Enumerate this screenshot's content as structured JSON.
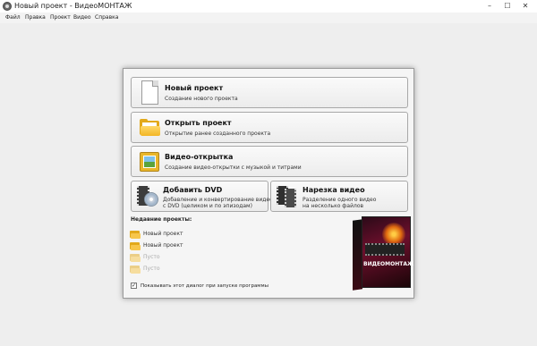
{
  "window": {
    "title": "Новый проект - ВидеоМОНТАЖ",
    "minimize": "–",
    "maximize": "☐",
    "close": "✕"
  },
  "menu": [
    "Файл",
    "Правка",
    "Проект",
    "Видео",
    "Справка"
  ],
  "actions": {
    "new_project": {
      "title": "Новый проект",
      "desc": "Создание нового проекта",
      "icon": "document-icon"
    },
    "open_project": {
      "title": "Открыть проект",
      "desc": "Открытие ранее созданного проекта",
      "icon": "folder-icon"
    },
    "video_card": {
      "title": "Видео-открытка",
      "desc": "Создание видео-открытки с музыкой и титрами",
      "icon": "photo-icon"
    },
    "add_dvd": {
      "title": "Добавить DVD",
      "desc_line1": "Добавление и конвертирование видео",
      "desc_line2": "с DVD (целиком и по эпизодам)",
      "icon": "dvd-icon"
    },
    "cut_video": {
      "title": "Нарезка видео",
      "desc_line1": "Разделение одного видео",
      "desc_line2": "на несколько файлов",
      "icon": "film-icon"
    }
  },
  "recent": {
    "header": "Недавние проекты:",
    "items": [
      "Новый проект",
      "Новый проект",
      "Пусто",
      "Пусто"
    ]
  },
  "options": {
    "show_on_startup_label": "Показывать этот диалог при запуске программы",
    "show_on_startup_checked": true,
    "checkmark": "✓"
  },
  "product": {
    "brand": "ВИДЕОМОНТАЖ"
  }
}
